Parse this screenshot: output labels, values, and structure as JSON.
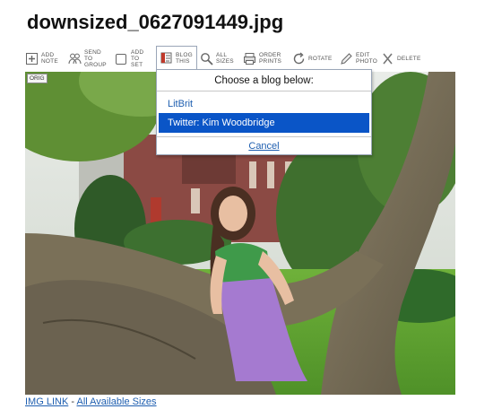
{
  "photo_title": "downsized_0627091449.jpg",
  "toolbar": {
    "items": [
      {
        "label": "ADD\nNOTE",
        "icon": "add-note-icon"
      },
      {
        "label": "SEND TO\nGROUP",
        "icon": "send-to-group-icon"
      },
      {
        "label": "ADD\nTO SET",
        "icon": "add-to-set-icon"
      },
      {
        "label": "BLOG\nTHIS",
        "icon": "blog-this-icon"
      },
      {
        "label": "ALL\nSIZES",
        "icon": "all-sizes-icon"
      },
      {
        "label": "ORDER\nPRINTS",
        "icon": "order-prints-icon"
      },
      {
        "label": "ROTATE",
        "icon": "rotate-icon"
      },
      {
        "label": "EDIT\nPHOTO",
        "icon": "edit-photo-icon"
      },
      {
        "label": "DELETE",
        "icon": "delete-icon"
      }
    ]
  },
  "blog_dropdown": {
    "prompt": "Choose a blog below:",
    "options": [
      "LitBrit",
      "Twitter: Kim Woodbridge"
    ],
    "selected": "Twitter: Kim Woodbridge",
    "cancel": "Cancel"
  },
  "photo": {
    "badge": "ORIG"
  },
  "footer": {
    "img_link": "IMG LINK",
    "separator": "-",
    "all_sizes": "All Available Sizes"
  },
  "colors": {
    "link": "#1f5fb0",
    "selection": "#0a55c7"
  }
}
